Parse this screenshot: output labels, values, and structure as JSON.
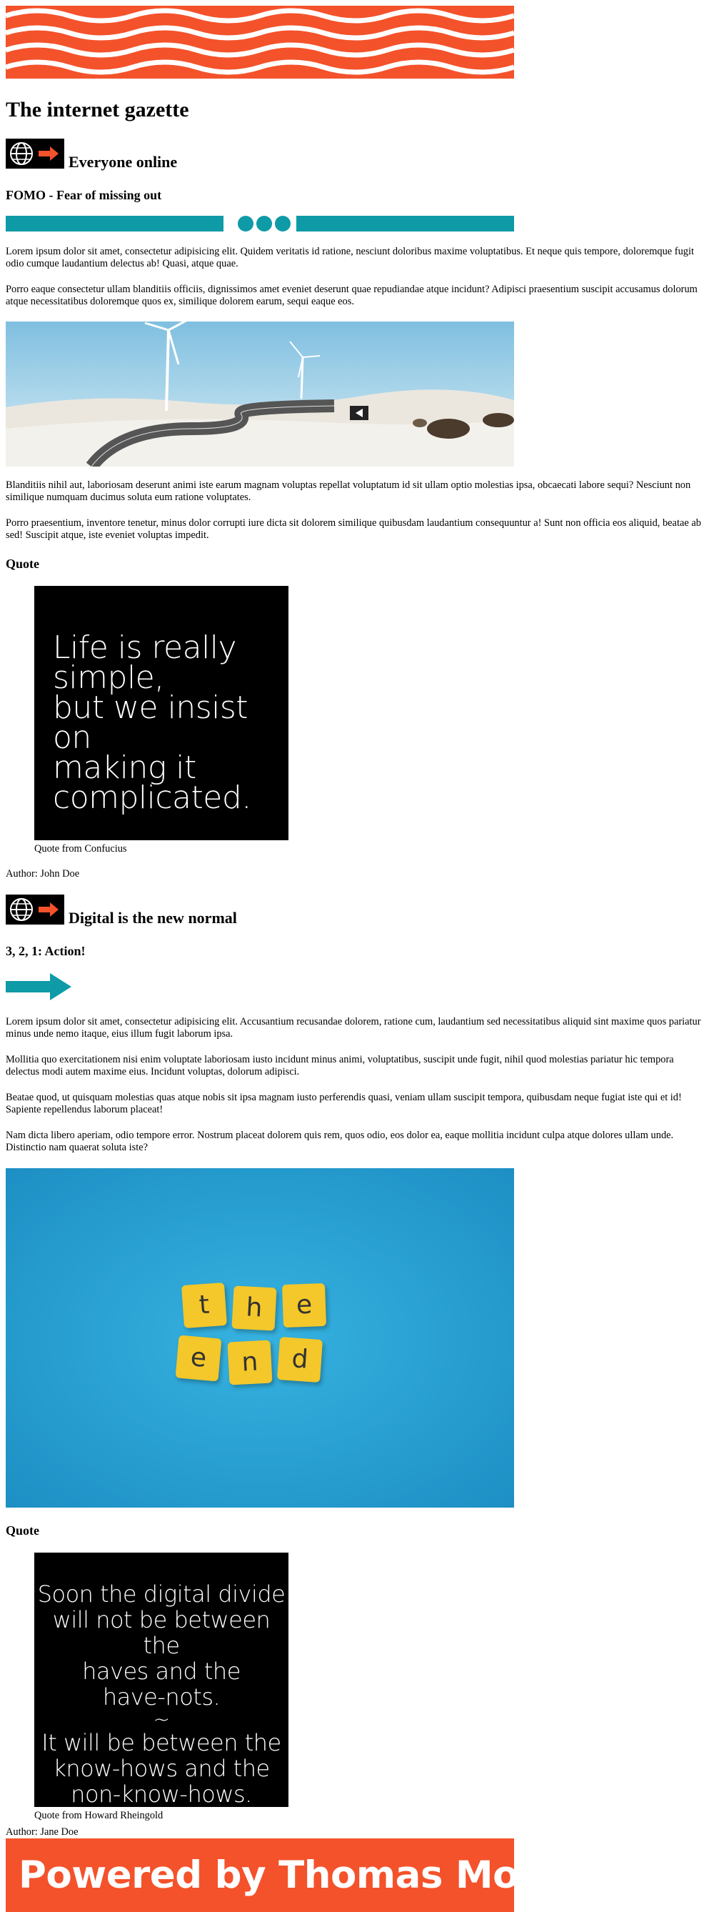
{
  "site_title": "The internet gazette",
  "colors": {
    "accent_orange": "#f4522b",
    "accent_teal": "#0e9aa7",
    "sky_blue": "#27a3d6",
    "tile_yellow": "#f4c72a"
  },
  "sections": [
    {
      "icon": "globe-arrow-icon",
      "heading": "Everyone online",
      "subheading": "FOMO - Fear of missing out",
      "paragraphs": [
        "Lorem ipsum dolor sit amet, consectetur adipisicing elit. Quidem veritatis id ratione, nesciunt doloribus maxime voluptatibus. Et neque quis tempore, doloremque fugit odio cumque laudantium delectus ab! Quasi, atque quae.",
        "Porro eaque consectetur ullam blanditiis officiis, dignissimos amet eveniet deserunt quae repudiandae atque incidunt? Adipisci praesentium suscipit accusamus dolorum atque necessitatibus doloremque quos ex, similique dolorem earum, sequi eaque eos.",
        "Blanditiis nihil aut, laboriosam deserunt animi iste earum magnam voluptas repellat voluptatum id sit ullam optio molestias ipsa, obcaecati labore sequi? Nesciunt non similique numquam ducimus soluta eum ratione voluptates.",
        "Porro praesentium, inventore tenetur, minus dolor corrupti iure dicta sit dolorem similique quibusdam laudantium consequuntur a! Sunt non officia eos aliquid, beatae ab sed! Suscipit atque, iste eveniet voluptas impedit."
      ],
      "quote_label": "Quote",
      "quote_text": [
        "Life is really",
        "simple,",
        "but we insist on",
        "making it",
        "complicated."
      ],
      "quote_caption": "Quote from Confucius",
      "author": "Author: John Doe"
    },
    {
      "icon": "globe-arrow-icon",
      "heading": "Digital is the new normal",
      "subheading": "3, 2, 1: Action!",
      "paragraphs": [
        "Lorem ipsum dolor sit amet, consectetur adipisicing elit. Accusantium recusandae dolorem, ratione cum, laudantium sed necessitatibus aliquid sint maxime quos pariatur minus unde nemo itaque, eius illum fugit laborum ipsa.",
        "Mollitia quo exercitationem nisi enim voluptate laboriosam iusto incidunt minus animi, voluptatibus, suscipit unde fugit, nihil quod molestias pariatur hic tempora delectus modi autem maxime eius. Incidunt voluptas, dolorum adipisci.",
        "Beatae quod, ut quisquam molestias quas atque nobis sit ipsa magnam iusto perferendis quasi, veniam ullam suscipit tempora, quibusdam neque fugiat iste qui et id! Sapiente repellendus laborum placeat!",
        "Nam dicta libero aperiam, odio tempore error. Nostrum placeat dolorem quis rem, quos odio, eos dolor ea, eaque mollitia incidunt culpa atque dolores ullam unde. Distinctio nam quaerat soluta iste?"
      ],
      "tiles_row1": [
        "t",
        "h",
        "e"
      ],
      "tiles_row2": [
        "e",
        "n",
        "d"
      ],
      "quote_label": "Quote",
      "quote_text_a": [
        "Soon the digital divide",
        "will not be between the",
        "haves and the",
        "have-nots."
      ],
      "quote_sep": "~",
      "quote_text_b": [
        "It will be between the",
        "know-hows and the",
        "non-know-hows."
      ],
      "quote_caption": "Quote from Howard Rheingold",
      "author": "Author: Jane Doe"
    }
  ],
  "footer": {
    "text": "Powered by Thomas More"
  }
}
